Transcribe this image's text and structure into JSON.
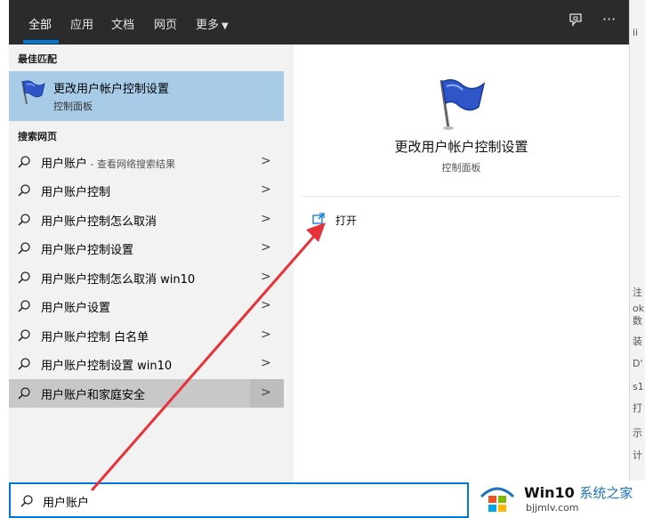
{
  "tabs": [
    "全部",
    "应用",
    "文档",
    "网页",
    "更多"
  ],
  "left": {
    "best_match_heading": "最佳匹配",
    "best_match": {
      "title": "更改用户帐户控制设置",
      "subtitle": "控制面板"
    },
    "web_heading": "搜索网页",
    "results": [
      {
        "label": "用户账户",
        "suffix": " - 查看网络搜索结果"
      },
      {
        "label": "用户账户控制",
        "suffix": ""
      },
      {
        "label": "用户账户控制怎么取消",
        "suffix": ""
      },
      {
        "label": "用户账户控制设置",
        "suffix": ""
      },
      {
        "label": "用户账户控制怎么取消 win10",
        "suffix": ""
      },
      {
        "label": "用户账户设置",
        "suffix": ""
      },
      {
        "label": "用户账户控制 白名单",
        "suffix": ""
      },
      {
        "label": "用户账户控制设置 win10",
        "suffix": ""
      },
      {
        "label": "用户账户和家庭安全",
        "suffix": ""
      }
    ]
  },
  "right": {
    "title": "更改用户帐户控制设置",
    "subtitle": "控制面板",
    "open_label": "打开"
  },
  "search": {
    "value": "用户账户"
  },
  "watermark": {
    "title": "Win10",
    "title_cn": "系统之家",
    "url": "bjjmlv.com"
  },
  "background_fragments": [
    "ii",
    "注",
    "ok",
    "数",
    "装",
    "D'",
    "s1",
    "打",
    "示",
    "计"
  ],
  "colors": {
    "accent": "#0078d7",
    "selected": "#a8cce8",
    "topbar": "#2b2b2b",
    "arrow": "#e8323a"
  },
  "icons": [
    "search-icon",
    "flag-icon",
    "chevron-right-icon",
    "open-icon",
    "feedback-icon",
    "more-icon",
    "windows-logo"
  ]
}
